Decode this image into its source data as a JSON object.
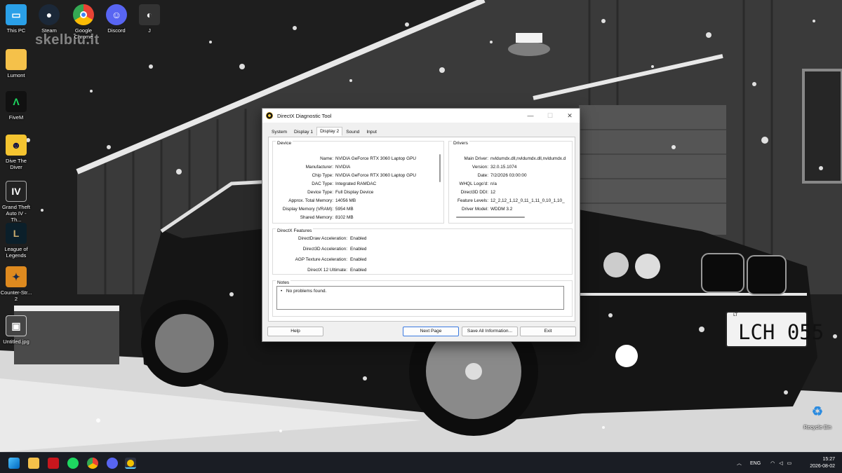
{
  "desktop": {
    "watermark": "skelbiu.lt",
    "icons": [
      {
        "label": "This PC",
        "icon": "this-pc-icon"
      },
      {
        "label": "Steam",
        "icon": "steam-icon"
      },
      {
        "label": "Google Chrome",
        "icon": "chrome-icon"
      },
      {
        "label": "Discord",
        "icon": "discord-icon"
      },
      {
        "label": "J",
        "icon": "user-folder-icon"
      },
      {
        "label": "Lumont",
        "icon": "folder-icon"
      },
      {
        "label": "FiveM",
        "icon": "fivem-icon"
      },
      {
        "label": "Dive The Diver",
        "icon": "dave-the-diver-icon"
      },
      {
        "label": "Grand Theft Auto IV - Th...",
        "icon": "gta-iv-icon"
      },
      {
        "label": "League of Legends",
        "icon": "league-of-legends-icon"
      },
      {
        "label": "Counter-Str... 2",
        "icon": "counter-strike-icon"
      },
      {
        "label": "Untitled.jpg",
        "icon": "image-file-icon"
      },
      {
        "label": "Recycle Bin",
        "icon": "recycle-bin-icon"
      }
    ],
    "plate": "LCH 055",
    "plate_country": "LT"
  },
  "window": {
    "title": "DirectX Diagnostic Tool",
    "controls": {
      "minimize": "—",
      "maximize": "☐",
      "close": "✕"
    },
    "tabs": [
      "System",
      "Display 1",
      "Display 2",
      "Sound",
      "Input"
    ],
    "active_tab": "Display 2",
    "device": {
      "title": "Device",
      "rows": [
        {
          "k": "Name:",
          "v": "NVIDIA GeForce RTX 3060 Laptop GPU"
        },
        {
          "k": "Manufacturer:",
          "v": "NVIDIA"
        },
        {
          "k": "Chip Type:",
          "v": "NVIDIA GeForce RTX 3060 Laptop GPU"
        },
        {
          "k": "DAC Type:",
          "v": "Integrated RAMDAC"
        },
        {
          "k": "Device Type:",
          "v": "Full Display Device"
        },
        {
          "k": "Approx. Total Memory:",
          "v": "14056 MB"
        },
        {
          "k": "Display Memory (VRAM):",
          "v": "5954 MB"
        },
        {
          "k": "Shared Memory:",
          "v": "8102 MB"
        }
      ]
    },
    "drivers": {
      "title": "Drivers",
      "rows": [
        {
          "k": "Main Driver:",
          "v": "nvldumdx.dll,nvldumdx.dll,nvldumdx.d"
        },
        {
          "k": "Version:",
          "v": "32.0.15.1074"
        },
        {
          "k": "Date:",
          "v": "7/2/2026 03:00:00"
        },
        {
          "k": "WHQL Logo'd:",
          "v": "n/a"
        },
        {
          "k": "Direct3D DDI:",
          "v": "12"
        },
        {
          "k": "Feature Levels:",
          "v": "12_2,12_1,12_0,11_1,11_0,10_1,10_"
        },
        {
          "k": "Driver Model:",
          "v": "WDDM 3.2"
        }
      ]
    },
    "features": {
      "title": "DirectX Features",
      "rows": [
        {
          "k": "DirectDraw Acceleration:",
          "v": "Enabled"
        },
        {
          "k": "Direct3D Acceleration:",
          "v": "Enabled"
        },
        {
          "k": "AGP Texture Acceleration:",
          "v": "Enabled"
        },
        {
          "k": "DirectX 12 Ultimate:",
          "v": "Enabled"
        }
      ]
    },
    "notes": {
      "title": "Notes",
      "items": [
        "No problems found."
      ]
    },
    "buttons": {
      "help": "Help",
      "next": "Next Page",
      "save": "Save All Information...",
      "exit": "Exit"
    }
  },
  "taskbar": {
    "apps": [
      "windows-start-icon",
      "file-explorer-icon",
      "app-red-icon",
      "spotify-icon",
      "chrome-icon",
      "discord-icon",
      "dxdiag-icon"
    ],
    "language": "ENG",
    "time": "15:27",
    "date": "2026-08-02"
  },
  "colors": {
    "accent": "#3b7ae0",
    "taskbar": "#1a1d24"
  }
}
